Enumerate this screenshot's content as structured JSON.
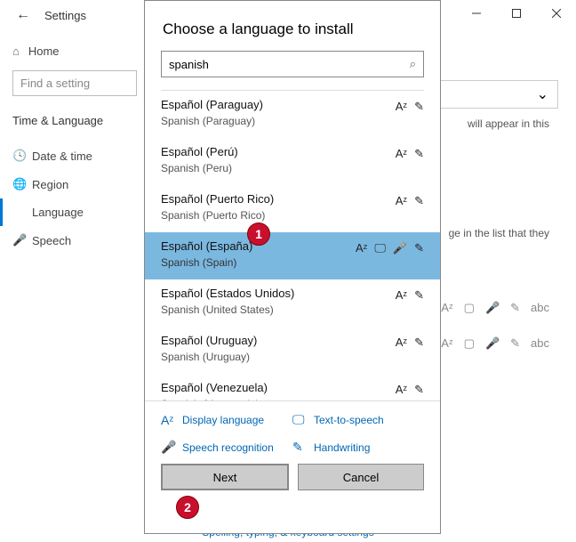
{
  "window": {
    "title": "Settings"
  },
  "sidebar": {
    "home": "Home",
    "find_placeholder": "Find a setting",
    "section": "Time & Language",
    "items": [
      "Date & time",
      "Region",
      "Language",
      "Speech"
    ]
  },
  "bg": {
    "text1": "will appear in this",
    "text2": "ge in the list that they",
    "link": "Spelling, typing, & keyboard settings"
  },
  "modal": {
    "title": "Choose a language to install",
    "search_value": "spanish",
    "langs": [
      {
        "native": "Español (Paraguay)",
        "eng": "Spanish (Paraguay)",
        "icons": [
          "disp",
          "hand"
        ]
      },
      {
        "native": "Español (Perú)",
        "eng": "Spanish (Peru)",
        "icons": [
          "disp",
          "hand"
        ]
      },
      {
        "native": "Español (Puerto Rico)",
        "eng": "Spanish (Puerto Rico)",
        "icons": [
          "disp",
          "hand"
        ]
      },
      {
        "native": "Español (España)",
        "eng": "Spanish (Spain)",
        "icons": [
          "disp",
          "tts",
          "speech",
          "hand"
        ],
        "selected": true
      },
      {
        "native": "Español (Estados Unidos)",
        "eng": "Spanish (United States)",
        "icons": [
          "disp",
          "hand"
        ]
      },
      {
        "native": "Español (Uruguay)",
        "eng": "Spanish (Uruguay)",
        "icons": [
          "disp",
          "hand"
        ]
      },
      {
        "native": "Español (Venezuela)",
        "eng": "Spanish (Venezuela)",
        "icons": [
          "disp",
          "hand"
        ]
      }
    ],
    "legend": {
      "display": "Display language",
      "tts": "Text-to-speech",
      "speech": "Speech recognition",
      "hand": "Handwriting"
    },
    "next": "Next",
    "cancel": "Cancel"
  },
  "markers": {
    "m1": "1",
    "m2": "2"
  }
}
